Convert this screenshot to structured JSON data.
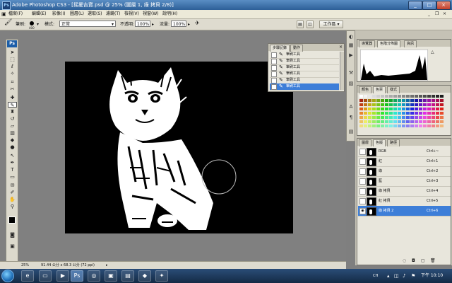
{
  "window": {
    "title": "Adobe Photoshop CS3 - [摇擺吉寶.psd @ 25% (圖層 1, 綠 拷貝 2/8)]",
    "app_logo": "Ps",
    "minimize_icon": "minimize-icon",
    "maximize_icon": "maximize-icon",
    "close_icon": "close-icon"
  },
  "menu": {
    "items": [
      "檔案(F)",
      "編輯(E)",
      "影像(I)",
      "圖層(L)",
      "選取(S)",
      "濾鏡(T)",
      "檢視(V)",
      "視窗(W)",
      "說明(H)"
    ]
  },
  "options": {
    "brush_label": "筆刷:",
    "brush_size": "400",
    "mode_label": "模式:",
    "mode_value": "正常",
    "opacity_label": "不透明:",
    "opacity_value": "100%",
    "flow_label": "流量:",
    "flow_value": "100%",
    "workspace_label": "工作區 ▾"
  },
  "toolbox": {
    "logo": "Ps"
  },
  "history": {
    "tabs": [
      "步驟記錄",
      "動作"
    ],
    "items": [
      {
        "label": "筆刷工具",
        "selected": false
      },
      {
        "label": "筆刷工具",
        "selected": false
      },
      {
        "label": "筆刷工具",
        "selected": false
      },
      {
        "label": "筆刷工具",
        "selected": false
      },
      {
        "label": "筆刷工具",
        "selected": false
      },
      {
        "label": "筆刷工具",
        "selected": true
      }
    ]
  },
  "panels": {
    "histogram_tabs": [
      "導覽器",
      "色階分佈圖",
      "資訊"
    ],
    "color_tabs": [
      "顏色",
      "色票",
      "樣式"
    ],
    "channel_tabs": [
      "圖層",
      "色版",
      "路徑"
    ],
    "channels": [
      {
        "name": "RGB",
        "shortcut": "Ctrl+~",
        "selected": false
      },
      {
        "name": "紅",
        "shortcut": "Ctrl+1",
        "selected": false
      },
      {
        "name": "綠",
        "shortcut": "Ctrl+2",
        "selected": false
      },
      {
        "name": "藍",
        "shortcut": "Ctrl+3",
        "selected": false
      },
      {
        "name": "綠 拷貝",
        "shortcut": "Ctrl+4",
        "selected": false
      },
      {
        "name": "紅 拷貝",
        "shortcut": "Ctrl+5",
        "selected": false
      },
      {
        "name": "綠 拷貝 2",
        "shortcut": "Ctrl+6",
        "selected": true
      }
    ]
  },
  "status": {
    "zoom": "25%",
    "doc_info": "91.44 公分 x 68.3 公分 (72 ppi)"
  },
  "taskbar": {
    "lang": "CH",
    "time": "下午 10:10"
  },
  "colors": {
    "selection": "#3d7ed8",
    "canvas": "#000000",
    "workspace": "#7f7f7f"
  }
}
